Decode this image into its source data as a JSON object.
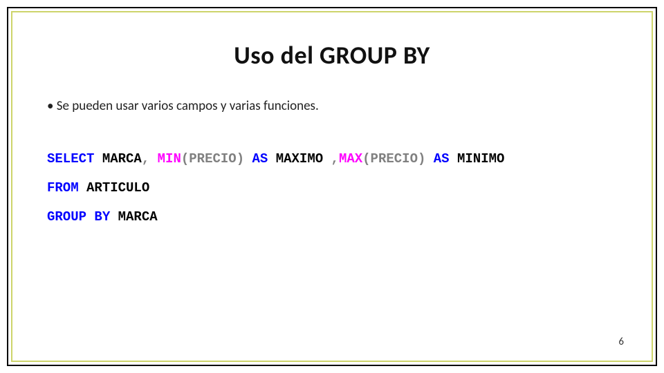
{
  "slide": {
    "title": "Uso del GROUP BY",
    "bullet": "Se pueden usar varios campos y varias funciones.",
    "page_number": "6"
  },
  "sql": {
    "line1": {
      "kw_select": "SELECT",
      "col_marca": " MARCA",
      "comma1": ",",
      "space1": " ",
      "fn_min": "MIN",
      "arg_min": "(PRECIO) ",
      "kw_as1": "AS",
      "alias_max": " MAXIMO ",
      "comma2": " ,",
      "fn_max": "MAX",
      "arg_max": "(PRECIO) ",
      "kw_as2": "AS",
      "alias_min": " MINIMO"
    },
    "line2": {
      "kw_from": "FROM",
      "tbl": " ARTICULO"
    },
    "line3": {
      "kw_group_by": "GROUP BY",
      "col": " MARCA"
    }
  }
}
